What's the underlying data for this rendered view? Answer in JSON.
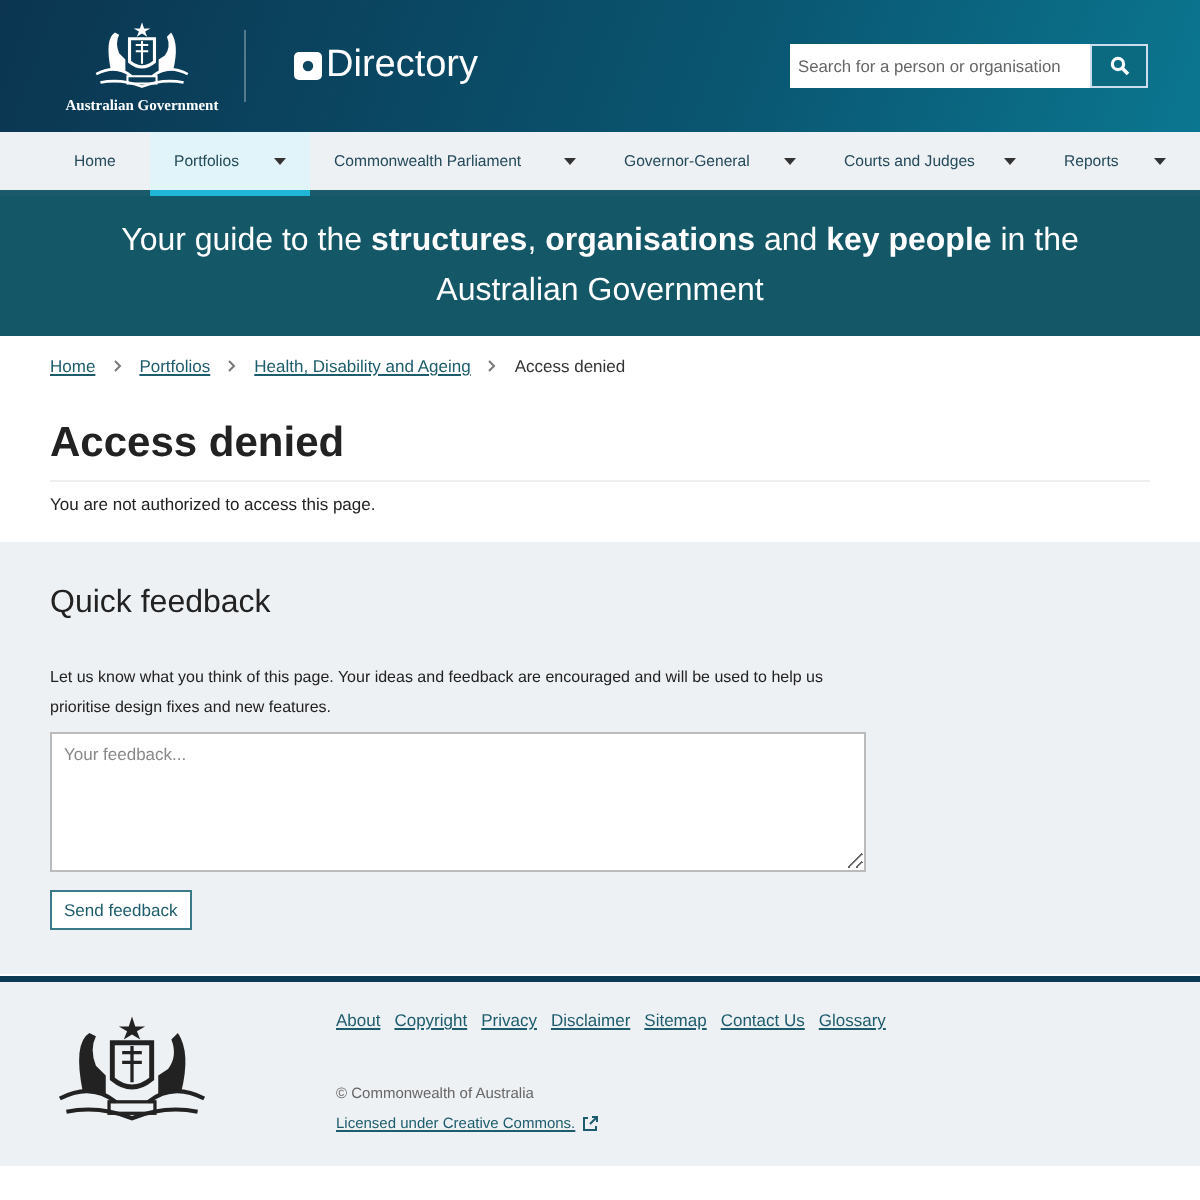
{
  "header": {
    "agency": "Australian Government",
    "site_title": "Directory",
    "search": {
      "placeholder": "Search for a person or organisation"
    }
  },
  "nav": [
    {
      "label": "Home",
      "selected": false,
      "dropdown": false
    },
    {
      "label": "Portfolios",
      "selected": true,
      "dropdown": true
    },
    {
      "label": "Commonwealth Parliament",
      "selected": false,
      "dropdown": true
    },
    {
      "label": "Governor-General",
      "selected": false,
      "dropdown": true
    },
    {
      "label": "Courts and Judges",
      "selected": false,
      "dropdown": true
    },
    {
      "label": "Reports",
      "selected": false,
      "dropdown": true
    }
  ],
  "banner": "Your guide to the **structures**, **organisations** and **key people** in the Australian Government",
  "breadcrumbs": [
    {
      "label": "Home",
      "link": true
    },
    {
      "label": "Portfolios",
      "link": true
    },
    {
      "label": "Health, Disability and Ageing",
      "link": true
    },
    {
      "label": "Access denied",
      "link": false
    }
  ],
  "page": {
    "title": "Access denied",
    "message": "You are not authorized to access this page."
  },
  "feedback": {
    "title": "Quick feedback",
    "intro": "Let us know what you think of this page. Your ideas and feedback are encouraged and will be used to help us prioritise design fixes and new features.",
    "placeholder": "Your feedback...",
    "button": "Send feedback"
  },
  "footer": {
    "links": [
      "About",
      "Copyright",
      "Privacy",
      "Disclaimer",
      "Sitemap",
      "Contact Us",
      "Glossary"
    ],
    "copyright": "© Commonwealth of Australia",
    "license": "Licensed under Creative Commons."
  }
}
